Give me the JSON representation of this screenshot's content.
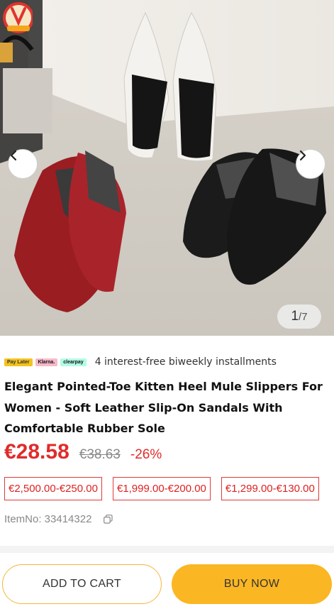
{
  "gallery": {
    "current": "1",
    "separator": "/",
    "total": "7",
    "promo_badge_icon": "v-gift-badge-icon"
  },
  "payment": {
    "logos": [
      "Pay Later",
      "Klarna.",
      "clearpay"
    ],
    "text": "4 interest-free biweekly installments"
  },
  "product": {
    "title": "Elegant Pointed-Toe Kitten Heel Mule Slippers For Women - Soft Leather Slip-On Sandals With Comfortable Rubber Sole",
    "price": "€28.58",
    "original_price": "€38.63",
    "discount": "-26%",
    "coupons": [
      "€2,500.00-€250.00",
      "€1,999.00-€200.00",
      "€1,299.00-€130.00"
    ],
    "item_no": "ItemNo: 33414322"
  },
  "actions": {
    "add_to_cart": "ADD TO CART",
    "buy_now": "BUY NOW"
  },
  "colors": {
    "accent": "#fbb623",
    "price": "#e02b2b"
  }
}
